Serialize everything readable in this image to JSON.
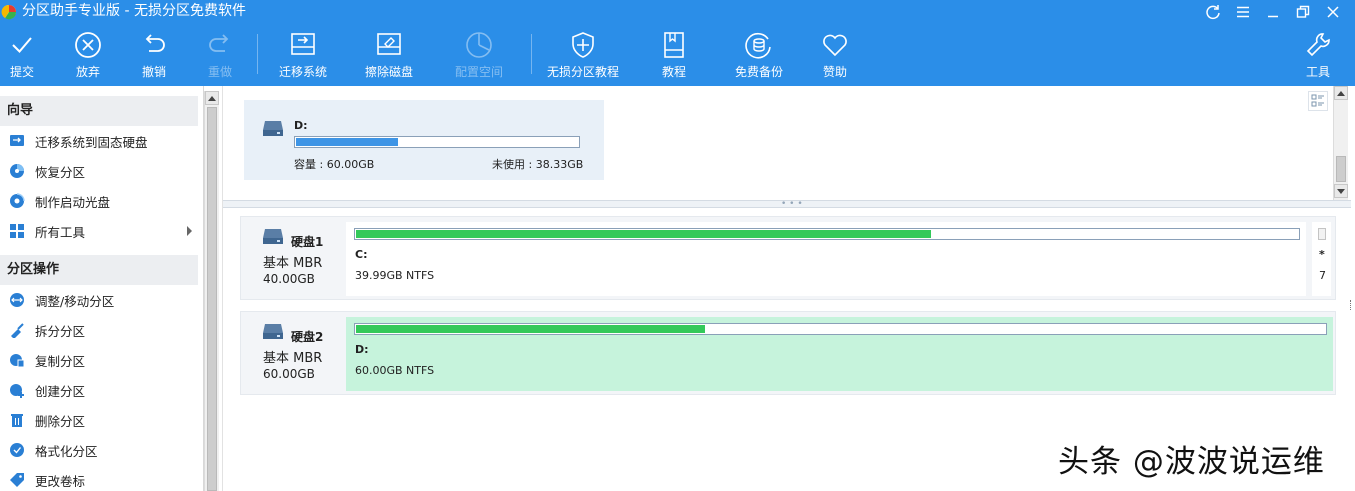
{
  "window": {
    "title": "分区助手专业版 - 无损分区免费软件"
  },
  "toolbar": {
    "buttons": [
      {
        "label": "提交",
        "icon": "check-icon",
        "enabled": true
      },
      {
        "label": "放弃",
        "icon": "cancel-circle-icon",
        "enabled": true
      },
      {
        "label": "撤销",
        "icon": "undo-icon",
        "enabled": true
      },
      {
        "label": "重做",
        "icon": "redo-icon",
        "enabled": false
      },
      {
        "label": "迁移系统",
        "icon": "migrate-disk-icon",
        "enabled": true
      },
      {
        "label": "擦除磁盘",
        "icon": "wipe-disk-icon",
        "enabled": true
      },
      {
        "label": "配置空间",
        "icon": "allocate-space-icon",
        "enabled": false
      },
      {
        "label": "无损分区教程",
        "icon": "shield-icon",
        "enabled": true
      },
      {
        "label": "教程",
        "icon": "book-icon",
        "enabled": true
      },
      {
        "label": "免费备份",
        "icon": "backup-icon",
        "enabled": true
      },
      {
        "label": "赞助",
        "icon": "heart-icon",
        "enabled": true
      },
      {
        "label": "工具",
        "icon": "wrench-icon",
        "enabled": true
      }
    ]
  },
  "sidebar": {
    "sections": [
      {
        "title": "向导",
        "items": [
          {
            "label": "迁移系统到固态硬盘",
            "icon": "migrate-ssd-icon"
          },
          {
            "label": "恢复分区",
            "icon": "recover-partition-icon"
          },
          {
            "label": "制作启动光盘",
            "icon": "boot-disc-icon"
          },
          {
            "label": "所有工具",
            "icon": "all-tools-icon",
            "has_submenu": true
          }
        ]
      },
      {
        "title": "分区操作",
        "items": [
          {
            "label": "调整/移动分区",
            "icon": "resize-partition-icon"
          },
          {
            "label": "拆分分区",
            "icon": "split-partition-icon"
          },
          {
            "label": "复制分区",
            "icon": "copy-partition-icon"
          },
          {
            "label": "创建分区",
            "icon": "create-partition-icon"
          },
          {
            "label": "删除分区",
            "icon": "delete-partition-icon"
          },
          {
            "label": "格式化分区",
            "icon": "format-partition-icon"
          },
          {
            "label": "更改卷标",
            "icon": "tag-icon"
          }
        ]
      }
    ]
  },
  "partition_card": {
    "drive": "D:",
    "used_fraction": 0.36,
    "capacity": "容量 : 60.00GB",
    "unused": "未使用 : 38.33GB"
  },
  "disks": [
    {
      "name": "硬盘1",
      "type": "基本 MBR",
      "size": "40.00GB",
      "partition": {
        "letter": "C:",
        "info": "39.99GB NTFS",
        "used_fraction": 0.61,
        "selected": false
      },
      "extra": [
        "*",
        "7"
      ]
    },
    {
      "name": "硬盘2",
      "type": "基本 MBR",
      "size": "60.00GB",
      "partition": {
        "letter": "D:",
        "info": "60.00GB NTFS",
        "used_fraction": 0.36,
        "selected": true
      }
    }
  ],
  "watermark": "头条 @波波说运维",
  "colors": {
    "titlebar": "#2b8ee8",
    "bar_blue": "#3e95e6",
    "bar_green": "#33c95a",
    "selected_partition": "#c6f3dc"
  }
}
